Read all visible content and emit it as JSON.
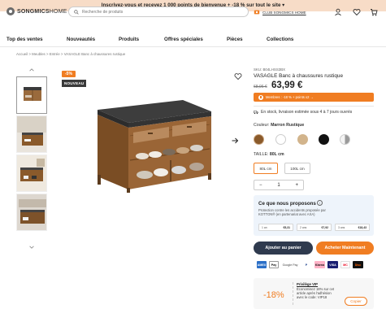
{
  "promo": {
    "text": "Inscrivez-vous et recevez 1 000 points de bienvenue + -18 % sur tout le site ▾"
  },
  "header": {
    "logo_bold": "SONGMICS",
    "logo_light": "HOME",
    "search_placeholder": "Recherche de produits",
    "club_label": "CLUB SONGMICS HOME",
    "icons": [
      "user-icon",
      "heart-icon",
      "cart-icon"
    ]
  },
  "nav": [
    "Top des ventes",
    "Nouveautés",
    "Produits",
    "Offres spéciales",
    "Pièces",
    "Collections"
  ],
  "breadcrumb": "Accueil > Meubles > Entrée > VASAGLE Banc à chaussures rustique",
  "gallery": {
    "discount_badge": "-5%",
    "new_badge": "NOUVEAU"
  },
  "product": {
    "sku": "SKU: B04LHSS3BX",
    "title": "VASAGLE Banc à chaussures rustique",
    "old_price": "68,96 €",
    "price": "63,99 €",
    "member_text": "Membres : -18 % + points x2 →",
    "stock_text": "En stock, livraison estimée sous 4 à 7 jours ouvrés",
    "color_prefix": "Couleur:",
    "color_value": "Marron Rustique",
    "swatches": [
      "#8a5a2b",
      "#ffffff",
      "#d2b48c",
      "#111111",
      "#c8c8c8"
    ],
    "size_prefix": "TAILLE:",
    "size_value": "80L cm",
    "sizes": [
      "80L cm",
      "100L cm"
    ],
    "qty_minus": "−",
    "qty_value": "1",
    "qty_plus": "+"
  },
  "propose": {
    "title": "Ce que nous proposons",
    "info": "i",
    "desc_line1": "Protection contre les accidents proposée par",
    "desc_line2": "KOTTON® (en partenariat avec AXA)",
    "plans": [
      {
        "label": "1 an",
        "price": "€5,31"
      },
      {
        "label": "2 ans",
        "price": "€7,92"
      },
      {
        "label": "3 ans",
        "price": "€18,43"
      }
    ]
  },
  "actions": {
    "add_to_cart": "Ajouter au panier",
    "buy_now": "Acheter Maintenant"
  },
  "payments": [
    "AMEX",
    "Pay",
    "Google Pay",
    "P",
    "Klarna",
    "VISA",
    "MC",
    "Disc"
  ],
  "vip": {
    "percent": "-18%",
    "title": "Privilège VIP",
    "desc": "Économisez 18% sur cet article après l'adhésion avec le code: VIP18",
    "copy": "Copier"
  }
}
